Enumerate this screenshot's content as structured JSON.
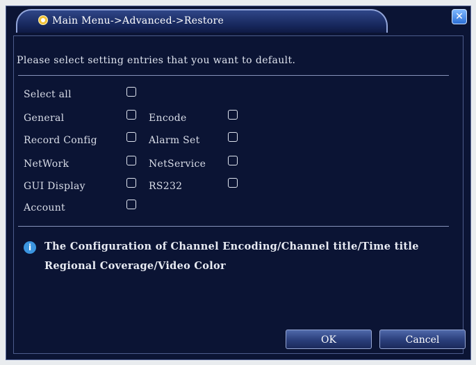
{
  "window": {
    "title": "Main Menu->Advanced->Restore",
    "close_symbol": "✕"
  },
  "prompt": "Please select setting entries that you want to default.",
  "options": {
    "select_all": "Select all",
    "general": "General",
    "encode": "Encode",
    "record_config": "Record Config",
    "alarm_set": "Alarm Set",
    "network": "NetWork",
    "netservice": "NetService",
    "gui_display": "GUI Display",
    "rs232": "RS232",
    "account": "Account"
  },
  "info": {
    "icon": "info-icon",
    "line1": "The Configuration of Channel Encoding/Channel title/Time title",
    "line2": "Regional Coverage/Video Color"
  },
  "buttons": {
    "ok": "OK",
    "cancel": "Cancel"
  },
  "colors": {
    "background": "#0b1434",
    "title_gradient": "#2f4688",
    "button_gradient": "#4f68aa",
    "info_icon": "#3b95e0"
  }
}
